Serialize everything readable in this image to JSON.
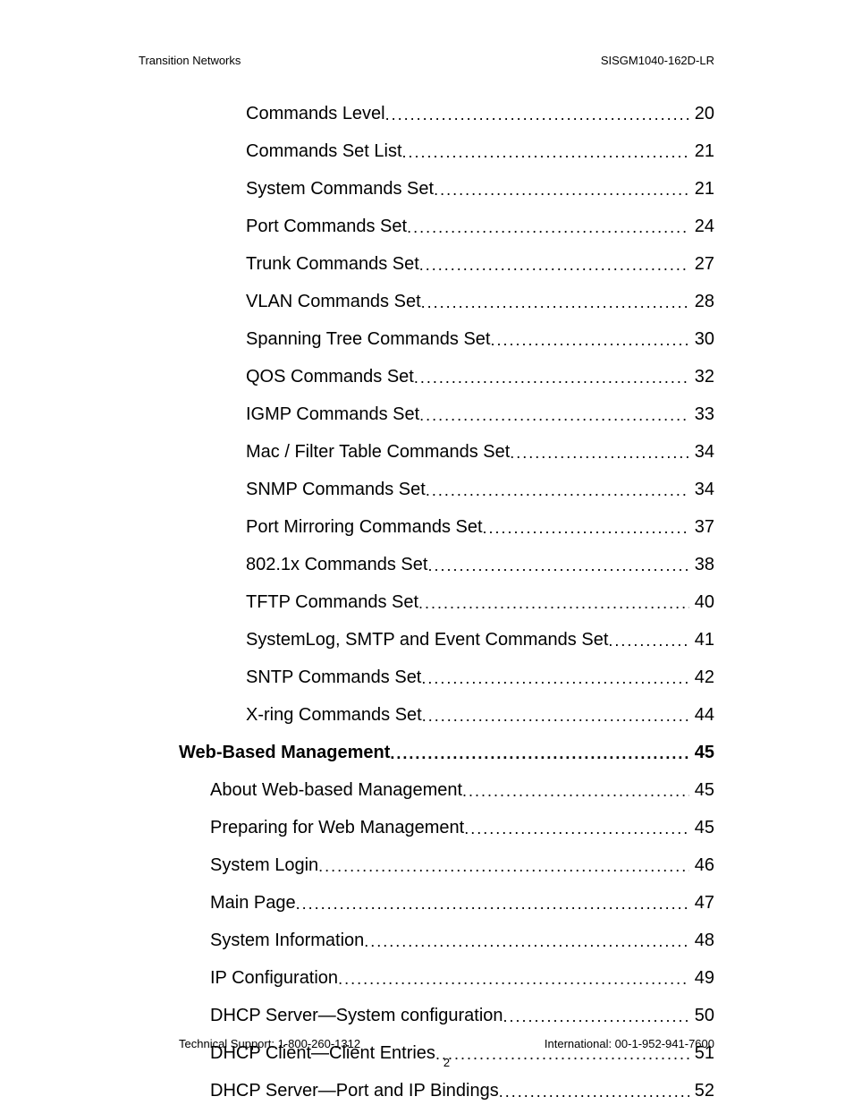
{
  "header": {
    "left": "Transition Networks",
    "right": "SISGM1040-162D-LR"
  },
  "toc_entries": [
    {
      "level": 3,
      "title": "Commands Level",
      "page": "20"
    },
    {
      "level": 3,
      "title": "Commands Set List",
      "page": "21"
    },
    {
      "level": 3,
      "title": "System Commands Set",
      "page": "21"
    },
    {
      "level": 3,
      "title": "Port Commands Set",
      "page": "24"
    },
    {
      "level": 3,
      "title": "Trunk Commands Set",
      "page": "27"
    },
    {
      "level": 3,
      "title": "VLAN Commands Set",
      "page": "28"
    },
    {
      "level": 3,
      "title": "Spanning Tree Commands Set",
      "page": "30"
    },
    {
      "level": 3,
      "title": "QOS Commands Set",
      "page": "32"
    },
    {
      "level": 3,
      "title": "IGMP Commands Set",
      "page": "33"
    },
    {
      "level": 3,
      "title": "Mac / Filter Table Commands Set",
      "page": "34"
    },
    {
      "level": 3,
      "title": "SNMP Commands Set",
      "page": "34"
    },
    {
      "level": 3,
      "title": "Port Mirroring Commands Set",
      "page": "37"
    },
    {
      "level": 3,
      "title": "802.1x Commands Set",
      "page": "38"
    },
    {
      "level": 3,
      "title": "TFTP Commands Set",
      "page": "40"
    },
    {
      "level": 3,
      "title": "SystemLog, SMTP and Event Commands Set",
      "page": "41"
    },
    {
      "level": 3,
      "title": "SNTP Commands Set",
      "page": "42"
    },
    {
      "level": 3,
      "title": "X-ring Commands Set",
      "page": "44"
    },
    {
      "level": 1,
      "title": "Web-Based Management",
      "page": "45"
    },
    {
      "level": 2,
      "title": "About Web-based Management",
      "page": "45"
    },
    {
      "level": 2,
      "title": "Preparing for Web Management",
      "page": "45"
    },
    {
      "level": 2,
      "title": "System Login",
      "page": "46"
    },
    {
      "level": 2,
      "title": "Main Page",
      "page": "47"
    },
    {
      "level": 2,
      "title": "System Information",
      "page": "48"
    },
    {
      "level": 2,
      "title": "IP Configuration",
      "page": "49"
    },
    {
      "level": 2,
      "title": "DHCP Server—System configuration",
      "page": "50"
    },
    {
      "level": 2,
      "title": "DHCP Client—Client Entries",
      "page": "51"
    },
    {
      "level": 2,
      "title": "DHCP Server—Port and IP Bindings",
      "page": "52"
    }
  ],
  "footer": {
    "left": "Technical Support: 1-800-260-1312",
    "right": "International: 00-1-952-941-7600",
    "page_number": "2"
  }
}
